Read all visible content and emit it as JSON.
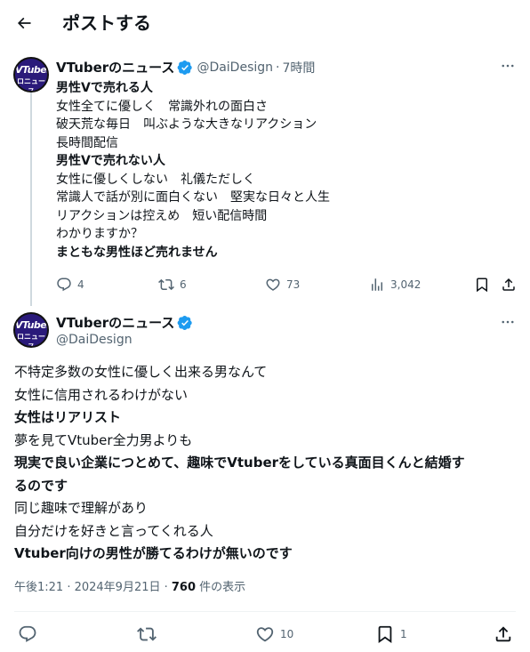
{
  "header": {
    "title": "ポストする"
  },
  "quoted": {
    "name": "VTuberのニュース",
    "handle": "@DaiDesign",
    "dot": "·",
    "time": "7時間",
    "avatar_line1": "VTuber",
    "avatar_line2": "ロニュース",
    "lines": [
      "男性Vで売れる人",
      "女性全てに優しく　常識外れの面白さ",
      "破天荒な毎日　叫ぶような大きなリアクション",
      "長時間配信",
      "男性Vで売れない人",
      "女性に優しくしない　礼儀ただしく",
      "常識人で話が別に面白くない　堅実な日々と人生",
      "リアクションは控えめ　短い配信時間",
      "わかりますか？",
      "まともな男性ほど売れません"
    ],
    "actions": {
      "replies": "4",
      "reposts": "6",
      "likes": "73",
      "views": "3,042"
    }
  },
  "main": {
    "name": "VTuberのニュース",
    "handle": "@DaiDesign",
    "avatar_line1": "VTuber",
    "avatar_line2": "ロニュース",
    "lines": [
      "不特定多数の女性に優しく出来る男なんて",
      "女性に信用されるわけがない",
      "女性はリアリスト",
      "夢を見てVtuber全力男よりも",
      "現実で良い企業につとめて、趣味でVtuberをしている真面目くんと結婚す",
      "るのです",
      "同じ趣味で理解があり",
      "自分だけを好きと言ってくれる人",
      "Vtuber向けの男性が勝てるわけが無いのです"
    ],
    "meta_time": "午後1:21 · 2024年9月21日 · ",
    "meta_views": "760",
    "meta_views_label": " 件の表示",
    "actions": {
      "likes": "10",
      "bookmarks": "1"
    }
  },
  "colors": {
    "text": "#0f1419",
    "secondary": "#536471",
    "verified": "#1d9bf0",
    "divider": "#eff3f4"
  }
}
